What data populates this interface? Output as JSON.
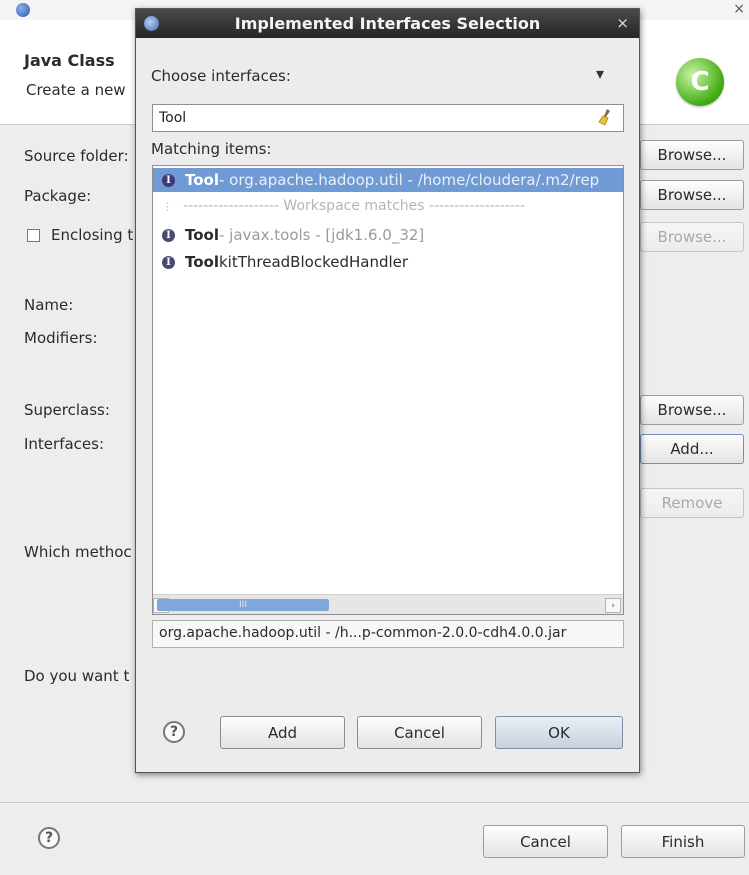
{
  "background_wizard": {
    "header_title": "Java Class",
    "header_subtitle": "Create a new",
    "labels": {
      "source_folder": "Source folder:",
      "package": "Package:",
      "enclosing": "Enclosing t",
      "name": "Name:",
      "modifiers": "Modifiers:",
      "superclass": "Superclass:",
      "interfaces": "Interfaces:",
      "which_methods": "Which methoc",
      "do_you_want": "Do you want t"
    },
    "buttons": {
      "browse_source": "Browse...",
      "browse_package": "Browse...",
      "browse_enclosing": "Browse...",
      "browse_superclass": "Browse...",
      "add_interface": "Add...",
      "remove_interface": "Remove",
      "cancel": "Cancel",
      "finish": "Finish"
    },
    "logo_letter": "C",
    "close_glyph": "×"
  },
  "dialog": {
    "title": "Implemented Interfaces Selection",
    "close_glyph": "×",
    "choose_label": "Choose interfaces:",
    "menu_glyph": "▾",
    "filter_value": "Tool",
    "matching_label": "Matching items:",
    "items": [
      {
        "name": "Tool",
        "rest": " - org.apache.hadoop.util - /home/cloudera/.m2/rep",
        "selected": true
      },
      {
        "separator": "------------------- Workspace matches -------------------"
      },
      {
        "name": "Tool",
        "rest": " - javax.tools - [jdk1.6.0_32]",
        "selected": false
      },
      {
        "name": "Tool",
        "rest_plain": "kitThreadBlockedHandler",
        "selected": false
      }
    ],
    "scroll_thumb_glyph": "III",
    "status_text": "org.apache.hadoop.util - /h...p-common-2.0.0-cdh4.0.0.jar",
    "buttons": {
      "add": "Add",
      "cancel": "Cancel",
      "ok": "OK"
    },
    "help_glyph": "?"
  },
  "icons": {
    "interface_letter": "I"
  },
  "colors": {
    "selection": "#6f9ad3",
    "titlebar": "#2f2f2f"
  }
}
